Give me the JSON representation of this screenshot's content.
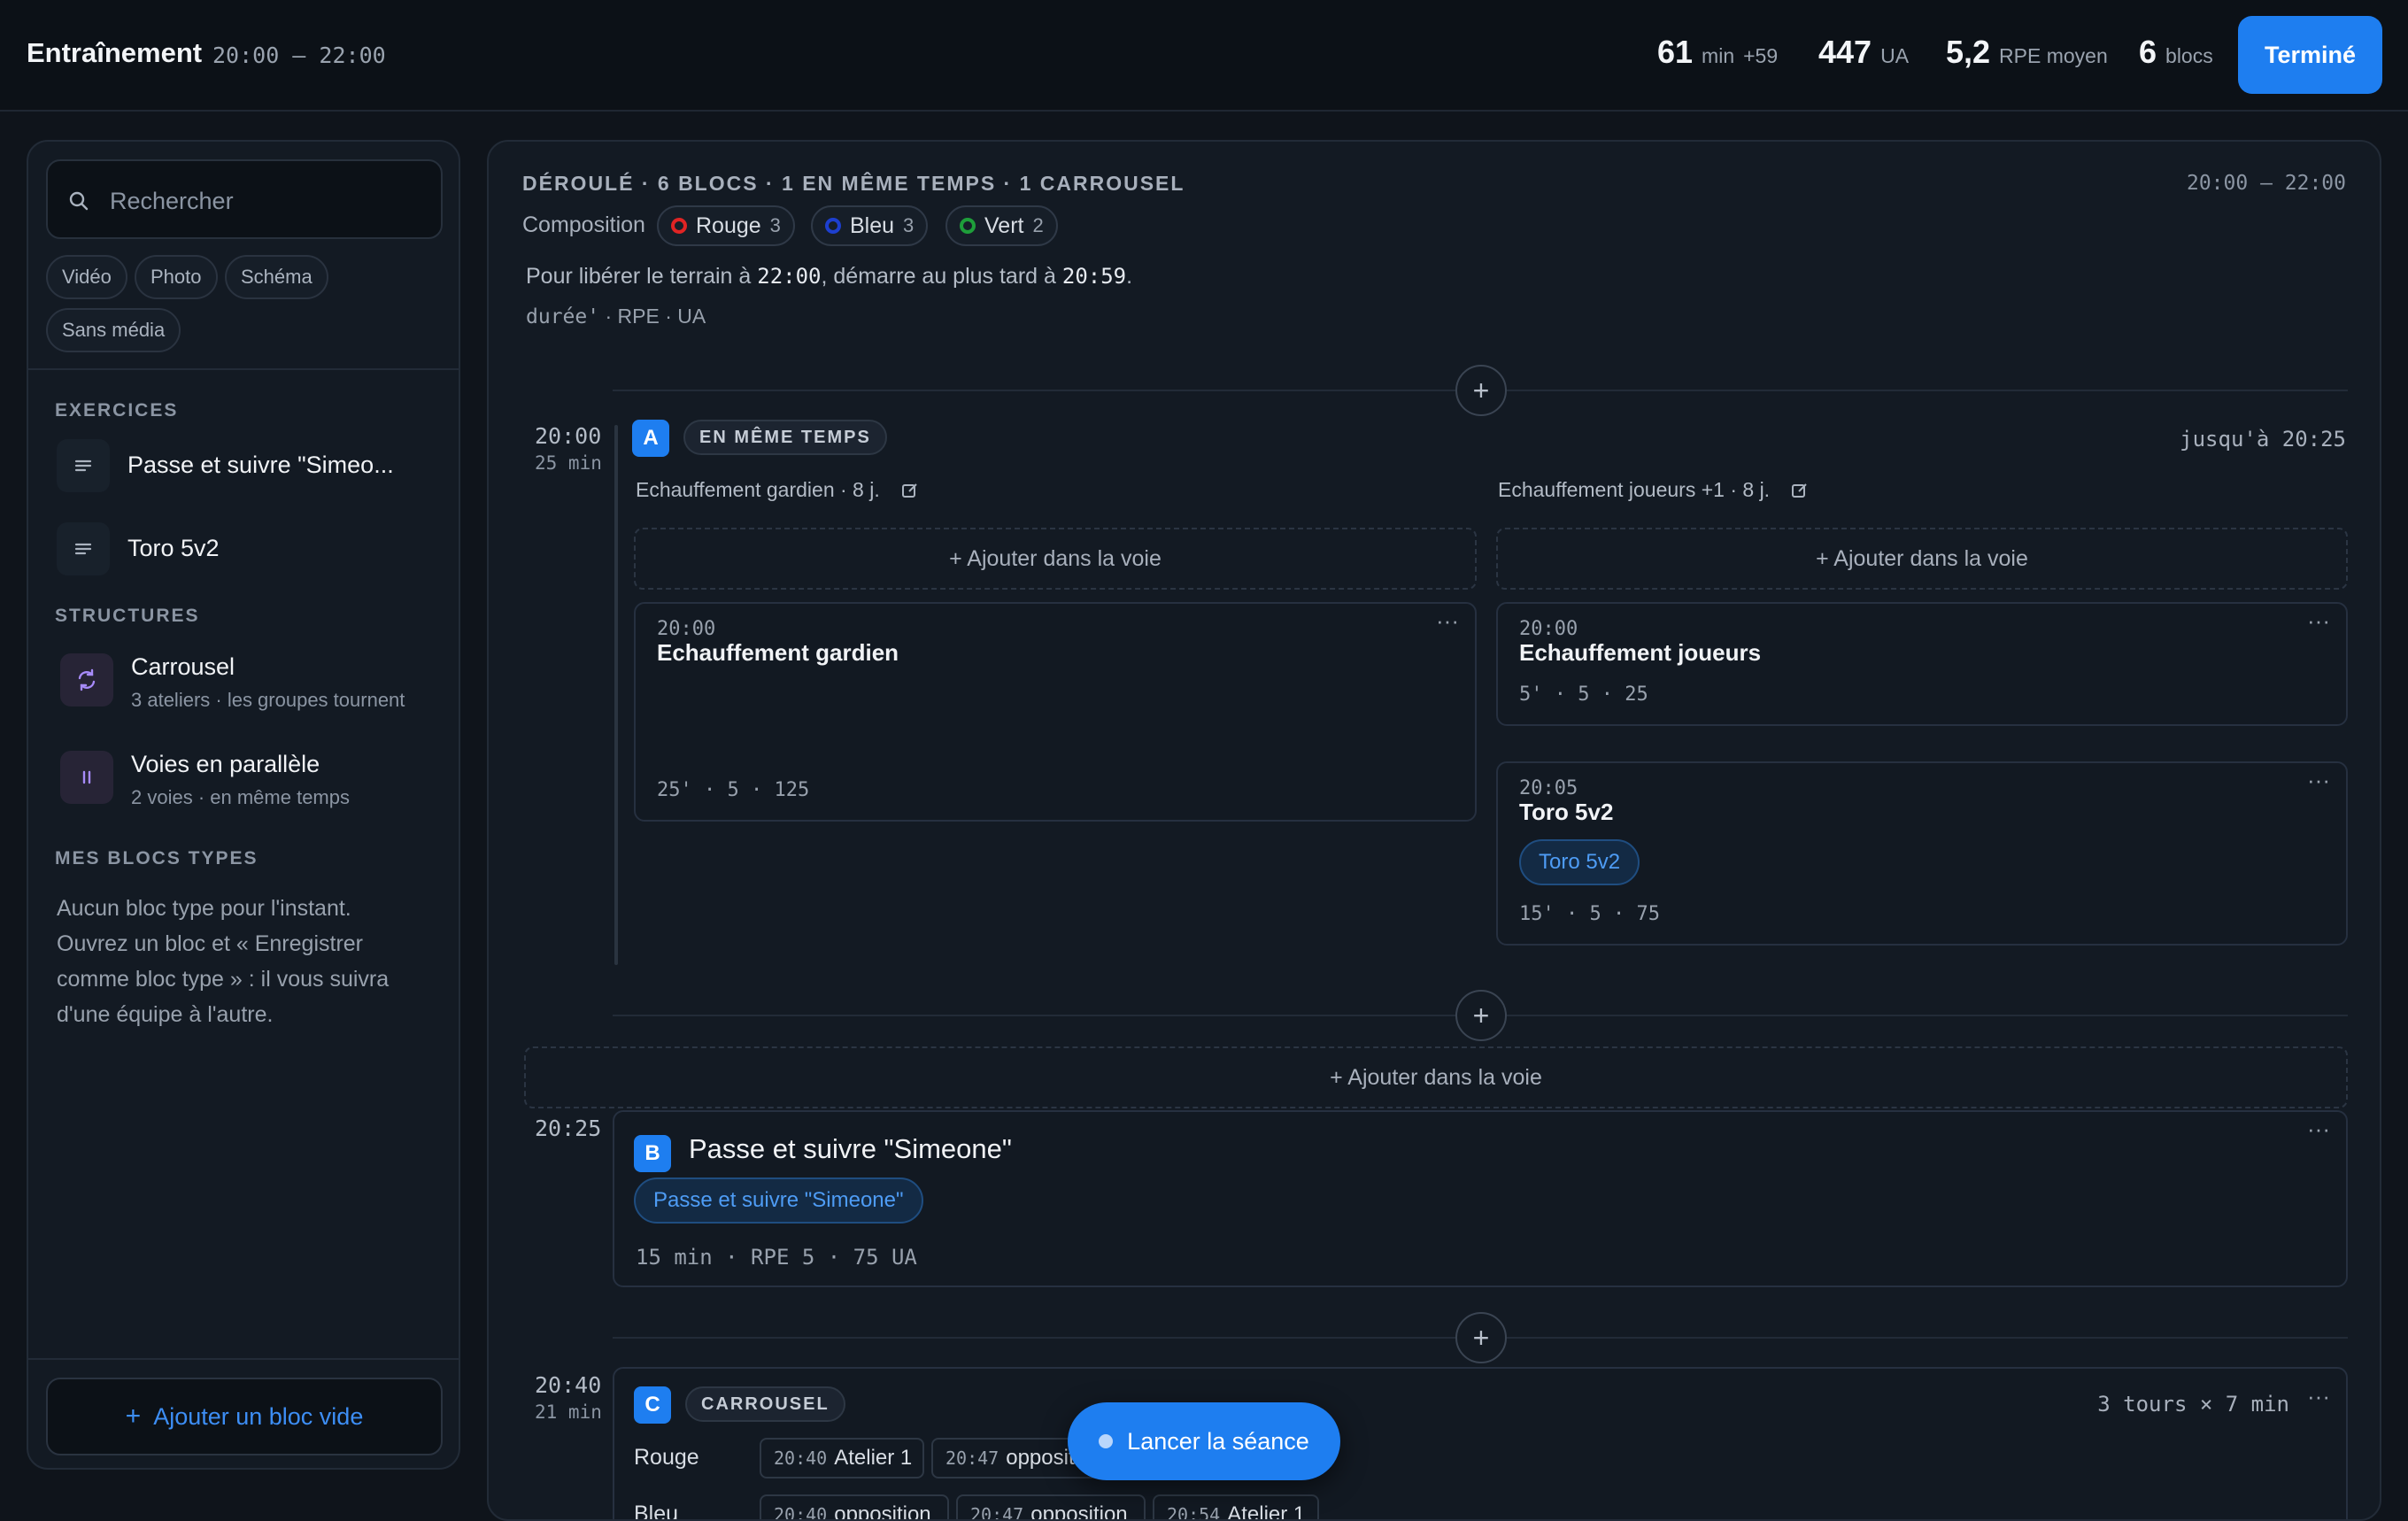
{
  "header": {
    "title": "Entraînement",
    "time_range": "20:00 – 22:00",
    "stats": {
      "duration_value": "61",
      "duration_unit": "min",
      "duration_delta": "+59",
      "load_value": "447",
      "load_unit": "UA",
      "rpe_value": "5,2",
      "rpe_unit": "RPE moyen",
      "blocks_value": "6",
      "blocks_unit": "blocs"
    },
    "done_label": "Terminé"
  },
  "sidebar": {
    "search_placeholder": "Rechercher",
    "filters": [
      "Vidéo",
      "Photo",
      "Schéma",
      "Sans média"
    ],
    "exercises_title": "EXERCICES",
    "exercises": [
      {
        "label": "Passe et suivre \"Simeo..."
      },
      {
        "label": "Toro 5v2"
      }
    ],
    "structures_title": "STRUCTURES",
    "structures": [
      {
        "label": "Carrousel",
        "sub": "3 ateliers · les groupes tournent"
      },
      {
        "label": "Voies en parallèle",
        "sub": "2 voies · en même temps"
      }
    ],
    "templates_title": "MES BLOCS TYPES",
    "templates_empty": "Aucun bloc type pour l'instant. Ouvrez un bloc et « Enregistrer comme bloc type » : il vous suivra d'une équipe à l'autre.",
    "add_empty_label": "Ajouter un bloc vide"
  },
  "main": {
    "summary": "DÉROULÉ · 6 BLOCS · 1 EN MÊME TEMPS · 1 CARROUSEL",
    "range": "20:00 – 22:00",
    "composition_label": "Composition",
    "teams": [
      {
        "name": "Rouge",
        "count": "3",
        "color": "#e02424"
      },
      {
        "name": "Bleu",
        "count": "3",
        "color": "#1d3fcf"
      },
      {
        "name": "Vert",
        "count": "2",
        "color": "#1e9e3a"
      }
    ],
    "deadline_prefix": "Pour libérer le terrain à",
    "deadline_end": "22:00",
    "deadline_mid": ", démarre au plus tard à",
    "deadline_start": "20:59",
    "deadline_suffix": ".",
    "legend_mono": "durée'",
    "legend_rest": " · RPE · UA",
    "add_in_lane": "+ Ajouter dans la voie",
    "block_a": {
      "time": "20:00",
      "duration": "25 min",
      "letter": "A",
      "tag": "EN MÊME TEMPS",
      "until": "jusqu'à 20:25",
      "lane1_title": "Echauffement gardien · 8 j.",
      "lane2_title": "Echauffement joueurs +1 · 8 j.",
      "card1": {
        "time": "20:00",
        "title": "Echauffement gardien",
        "meta": "25' · 5 · 125"
      },
      "card2": {
        "time": "20:00",
        "title": "Echauffement joueurs",
        "meta": "5' · 5 · 25"
      },
      "card3": {
        "time": "20:05",
        "title": "Toro 5v2",
        "pill": "Toro 5v2",
        "meta": "15' · 5 · 75"
      }
    },
    "block_b": {
      "time": "20:25",
      "letter": "B",
      "title": "Passe et suivre \"Simeone\"",
      "pill": "Passe et suivre \"Simeone\"",
      "meta": "15 min · RPE 5 · 75 UA"
    },
    "block_c": {
      "time": "20:40",
      "duration": "21 min",
      "letter": "C",
      "tag": "CARROUSEL",
      "rounds": "3 tours × 7 min",
      "row1_label": "Rouge",
      "row1_slots": [
        {
          "time": "20:40",
          "label": "Atelier 1"
        },
        {
          "time": "20:47",
          "label": "opposition"
        }
      ],
      "row2_label": "Bleu",
      "row2_slots": [
        {
          "time": "20:40",
          "label": "opposition"
        },
        {
          "time": "20:47",
          "label": "opposition"
        },
        {
          "time": "20:54",
          "label": "Atelier 1"
        }
      ]
    },
    "launch_label": "Lancer la séance"
  }
}
